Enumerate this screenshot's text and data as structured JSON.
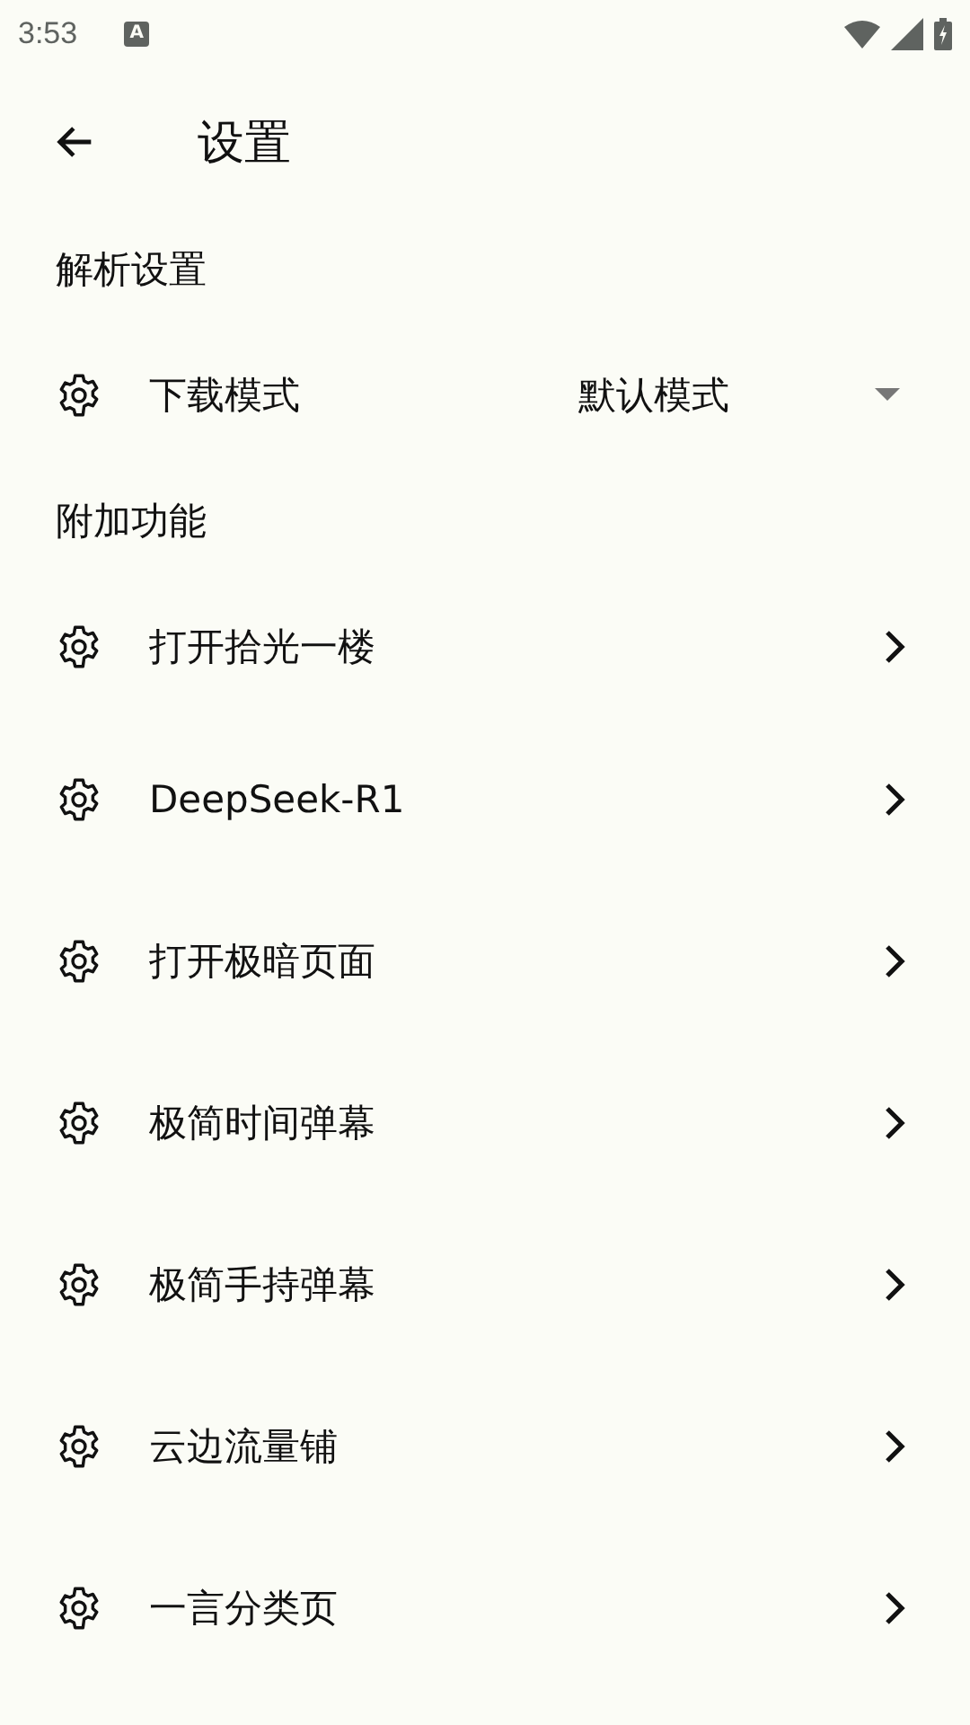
{
  "status_bar": {
    "time": "3:53",
    "notification_glyph": "A"
  },
  "app_bar": {
    "title": "设置"
  },
  "sections": [
    {
      "title": "解析设置",
      "items": [
        {
          "kind": "dropdown",
          "label": "下载模式",
          "value": "默认模式"
        }
      ]
    },
    {
      "title": "附加功能",
      "items": [
        {
          "kind": "link",
          "label": "打开拾光一楼"
        },
        {
          "kind": "link",
          "label": "DeepSeek-R1"
        },
        {
          "kind": "link",
          "label": "打开极暗页面"
        },
        {
          "kind": "link",
          "label": "极简时间弹幕"
        },
        {
          "kind": "link",
          "label": "极简手持弹幕"
        },
        {
          "kind": "link",
          "label": "云边流量铺"
        },
        {
          "kind": "link",
          "label": "一言分类页"
        }
      ]
    }
  ]
}
